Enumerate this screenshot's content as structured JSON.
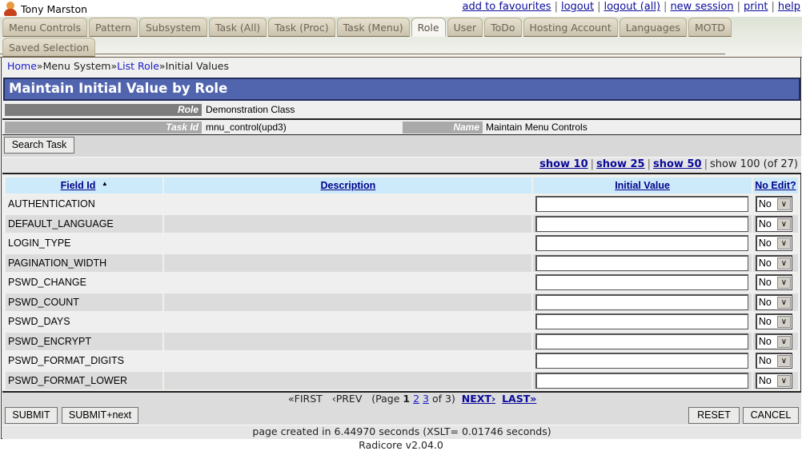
{
  "user": {
    "name": "Tony Marston",
    "icon": "user-avatar-icon"
  },
  "top_links": [
    {
      "label": "add to favourites"
    },
    {
      "label": "logout"
    },
    {
      "label": "logout (all)"
    },
    {
      "label": "new session"
    },
    {
      "label": "print"
    },
    {
      "label": "help"
    }
  ],
  "tabs_row1": [
    {
      "label": "Menu Controls",
      "active": false
    },
    {
      "label": "Pattern",
      "active": false
    },
    {
      "label": "Subsystem",
      "active": false
    },
    {
      "label": "Task (All)",
      "active": false
    },
    {
      "label": "Task (Proc)",
      "active": false
    },
    {
      "label": "Task (Menu)",
      "active": false
    },
    {
      "label": "Role",
      "active": true
    },
    {
      "label": "User",
      "active": false
    },
    {
      "label": "ToDo",
      "active": false
    },
    {
      "label": "Hosting Account",
      "active": false
    },
    {
      "label": "Languages",
      "active": false
    },
    {
      "label": "MOTD",
      "active": false
    }
  ],
  "tabs_row2": [
    {
      "label": "Saved Selection",
      "active": false
    }
  ],
  "breadcrumb": {
    "items": [
      {
        "label": "Home",
        "link": true
      },
      {
        "label": "Menu System",
        "link": false
      },
      {
        "label": "List Role",
        "link": true
      },
      {
        "label": "Initial Values",
        "link": false
      }
    ],
    "separator": "»"
  },
  "page_title": "Maintain Initial Value by Role",
  "info": {
    "role_label": "Role",
    "role_value": "Demonstration Class",
    "task_id_label": "Task Id",
    "task_id_value": "mnu_control(upd3)",
    "name_label": "Name",
    "name_value": "Maintain Menu Controls"
  },
  "search_button": "Search Task",
  "show_options": {
    "links": [
      "show 10",
      "show 25",
      "show 50"
    ],
    "current": "show 100",
    "total": "(of 27)"
  },
  "table": {
    "columns": {
      "field_id": "Field Id",
      "sort_icon": "▲",
      "description": "Description",
      "initial_value": "Initial Value",
      "no_edit": "No Edit?"
    },
    "rows": [
      {
        "field_id": "AUTHENTICATION",
        "description": "",
        "initial_value": "",
        "no_edit": "No"
      },
      {
        "field_id": "DEFAULT_LANGUAGE",
        "description": "",
        "initial_value": "",
        "no_edit": "No"
      },
      {
        "field_id": "LOGIN_TYPE",
        "description": "",
        "initial_value": "",
        "no_edit": "No"
      },
      {
        "field_id": "PAGINATION_WIDTH",
        "description": "",
        "initial_value": "",
        "no_edit": "No"
      },
      {
        "field_id": "PSWD_CHANGE",
        "description": "",
        "initial_value": "",
        "no_edit": "No"
      },
      {
        "field_id": "PSWD_COUNT",
        "description": "",
        "initial_value": "",
        "no_edit": "No"
      },
      {
        "field_id": "PSWD_DAYS",
        "description": "",
        "initial_value": "",
        "no_edit": "No"
      },
      {
        "field_id": "PSWD_ENCRYPT",
        "description": "",
        "initial_value": "",
        "no_edit": "No"
      },
      {
        "field_id": "PSWD_FORMAT_DIGITS",
        "description": "",
        "initial_value": "",
        "no_edit": "No"
      },
      {
        "field_id": "PSWD_FORMAT_LOWER",
        "description": "",
        "initial_value": "",
        "no_edit": "No"
      }
    ]
  },
  "pager": {
    "first": "«FIRST",
    "prev": "‹PREV",
    "page_prefix": "(Page",
    "current_page": "1",
    "pages": [
      "2",
      "3"
    ],
    "page_suffix": "of 3)",
    "next": "NEXT›",
    "last": "LAST»"
  },
  "actions": {
    "submit": "SUBMIT",
    "submit_next": "SUBMIT+next",
    "reset": "RESET",
    "cancel": "CANCEL"
  },
  "footer": {
    "timing": "page created in 6.44970 seconds (XSLT= 0.01746 seconds)",
    "version": "Radicore v2.04.0"
  }
}
